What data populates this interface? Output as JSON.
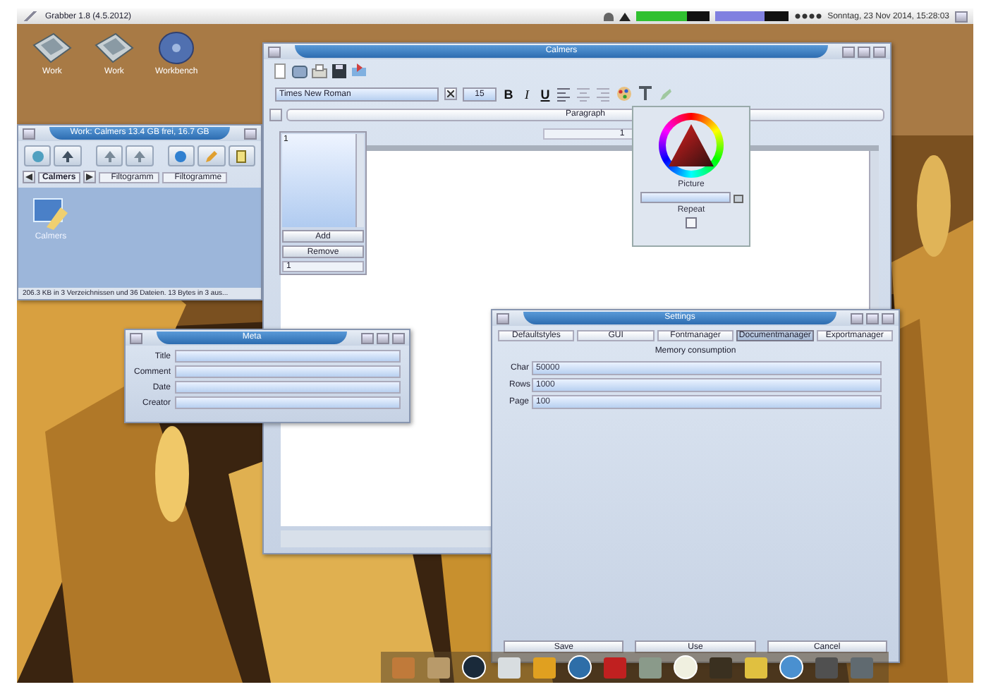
{
  "menu_bar": {
    "title": "Grabber 1.8 (4.5.2012)",
    "meters": [
      {
        "level": 0.7
      },
      {
        "level": 0.68
      }
    ],
    "clock": "Sonntag, 23 Nov 2014, 15:28:03"
  },
  "desktop_icons": [
    {
      "label": "Work",
      "kind": "disk"
    },
    {
      "label": "Work",
      "kind": "disk"
    },
    {
      "label": "Workbench",
      "kind": "cd"
    }
  ],
  "drawer_window": {
    "title": "Work: Calmers 13.4 GB frei, 16.7 GB",
    "path": "Calmers",
    "filters": [
      "Filtogramm",
      "Filtogramme"
    ],
    "icons": [
      {
        "label": "Calmers"
      }
    ],
    "status": "206.3 KB in 3 Verzeichnissen und 36 Dateien. 13 Bytes in 3 aus..."
  },
  "editor_window": {
    "title": "Calmers",
    "font": "Times New Roman",
    "size": "15",
    "format_buttons": [
      "B",
      "I",
      "U"
    ],
    "paragraph": "Paragraph",
    "ruler": "1",
    "list_items": [
      "1"
    ],
    "add": "Add",
    "remove": "Remove",
    "page": "1"
  },
  "color_popup": {
    "picture_label": "Picture",
    "repeat_label": "Repeat",
    "repeat_checked": false
  },
  "meta_window": {
    "title": "Meta",
    "fields": [
      "Title",
      "Comment",
      "Date",
      "Creator"
    ]
  },
  "settings_window": {
    "title": "Settings",
    "tabs": [
      {
        "label": "Defaultstyles",
        "selected": false
      },
      {
        "label": "GUI",
        "selected": false
      },
      {
        "label": "Fontmanager",
        "selected": false
      },
      {
        "label": "Documentmanager",
        "selected": true
      },
      {
        "label": "Exportmanager",
        "selected": false
      }
    ],
    "section": "Memory consumption",
    "fields": [
      {
        "label": "Char",
        "value": "50000"
      },
      {
        "label": "Rows",
        "value": "1000"
      },
      {
        "label": "Page",
        "value": "100"
      }
    ],
    "buttons": [
      "Save",
      "Use",
      "Cancel"
    ]
  }
}
